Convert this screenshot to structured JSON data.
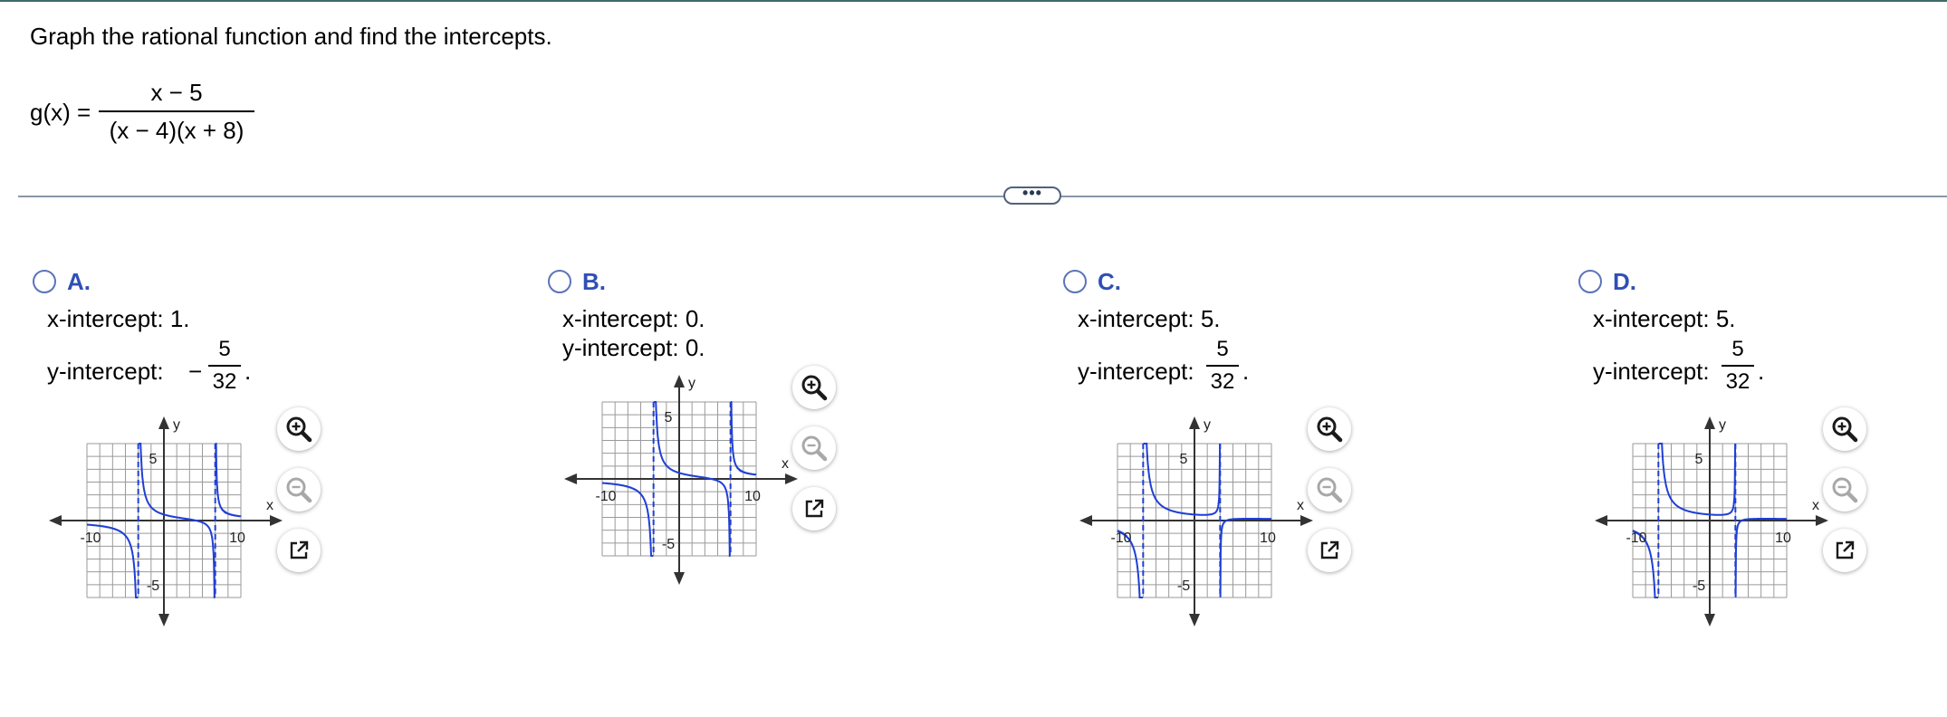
{
  "question": {
    "prompt": "Graph the rational function and find the intercepts.",
    "function_lhs": "g(x) =",
    "numerator": "x − 5",
    "denominator": "(x − 4)(x + 8)"
  },
  "divider": {
    "handle_label": "•••"
  },
  "options": [
    {
      "letter": "A.",
      "x_intercept_text": "x-intercept: 1.",
      "y_intercept_label": "y-intercept:",
      "y_intercept_sign": "−",
      "y_intercept_num": "5",
      "y_intercept_den": "32",
      "y_intercept_end": ".",
      "graph": {
        "x_axis_label": "x",
        "y_axis_label": "y",
        "x_tick_neg": "-10",
        "x_tick_pos": "10",
        "y_tick_pos": "5",
        "y_tick_neg": "-5",
        "asymptotes_x": [
          -4,
          8
        ]
      }
    },
    {
      "letter": "B.",
      "x_intercept_text": "x-intercept: 0.",
      "y_intercept_text": "y-intercept: 0.",
      "graph": {
        "x_axis_label": "x",
        "y_axis_label": "y",
        "x_tick_neg": "-10",
        "x_tick_pos": "10",
        "y_tick_pos": "5",
        "y_tick_neg": "-5",
        "asymptotes_x": [
          -4,
          8
        ]
      }
    },
    {
      "letter": "C.",
      "x_intercept_text": "x-intercept: 5.",
      "y_intercept_label": "y-intercept:",
      "y_intercept_sign": "",
      "y_intercept_num": "5",
      "y_intercept_den": "32",
      "y_intercept_end": ".",
      "graph": {
        "x_axis_label": "x",
        "y_axis_label": "y",
        "x_tick_neg": "-10",
        "x_tick_pos": "10",
        "y_tick_pos": "5",
        "y_tick_neg": "-5",
        "asymptotes_x": [
          -8,
          4
        ]
      }
    },
    {
      "letter": "D.",
      "x_intercept_text": "x-intercept: 5.",
      "y_intercept_label": "y-intercept:",
      "y_intercept_sign": "",
      "y_intercept_num": "5",
      "y_intercept_den": "32",
      "y_intercept_end": ".",
      "graph": {
        "x_axis_label": "x",
        "y_axis_label": "y",
        "x_tick_neg": "-10",
        "x_tick_pos": "10",
        "y_tick_pos": "5",
        "y_tick_neg": "-5",
        "asymptotes_x": [
          -8,
          4
        ]
      }
    }
  ],
  "tools": {
    "zoom_in_icon": "magnifier-plus-icon",
    "zoom_out_icon": "magnifier-minus-icon",
    "popout_icon": "external-link-icon"
  },
  "colors": {
    "curve": "#1f3fd6",
    "asymptote": "#1f3fd6",
    "grid": "#9a9a9a",
    "axis": "#333333",
    "accent": "#2f4fb5"
  }
}
